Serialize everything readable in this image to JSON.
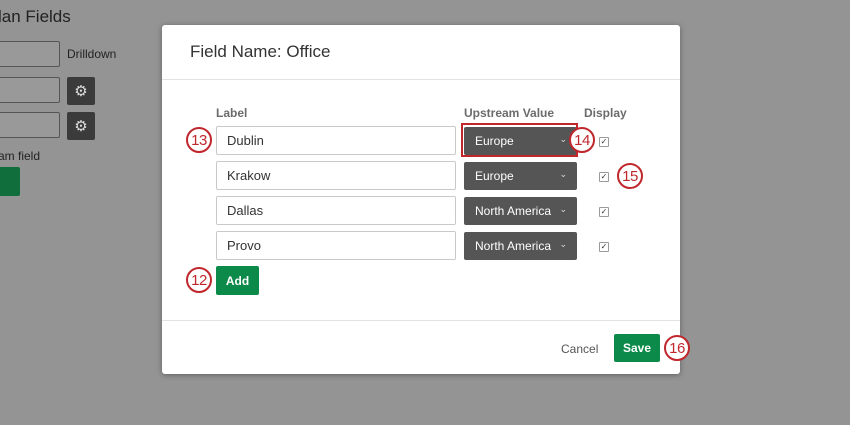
{
  "background": {
    "title": "lan Fields",
    "drilldown_label": "Drilldown",
    "upstream_field_label": "am field",
    "gear_icon": "gear-icon"
  },
  "modal": {
    "title": "Field Name: Office",
    "columns": {
      "label": "Label",
      "upstream": "Upstream Value",
      "display": "Display"
    },
    "rows": [
      {
        "label": "Dublin",
        "upstream": "Europe",
        "display": true
      },
      {
        "label": "Krakow",
        "upstream": "Europe",
        "display": true
      },
      {
        "label": "Dallas",
        "upstream": "North America",
        "display": true
      },
      {
        "label": "Provo",
        "upstream": "North America",
        "display": true
      }
    ],
    "add_label": "Add",
    "cancel_label": "Cancel",
    "save_label": "Save"
  },
  "callouts": {
    "c12": "12",
    "c13": "13",
    "c14": "14",
    "c15": "15",
    "c16": "16"
  },
  "colors": {
    "overlay": "#949494",
    "primary_green": "#0c8a4a",
    "select_bg": "#555555",
    "callout_red": "#c0272d"
  }
}
